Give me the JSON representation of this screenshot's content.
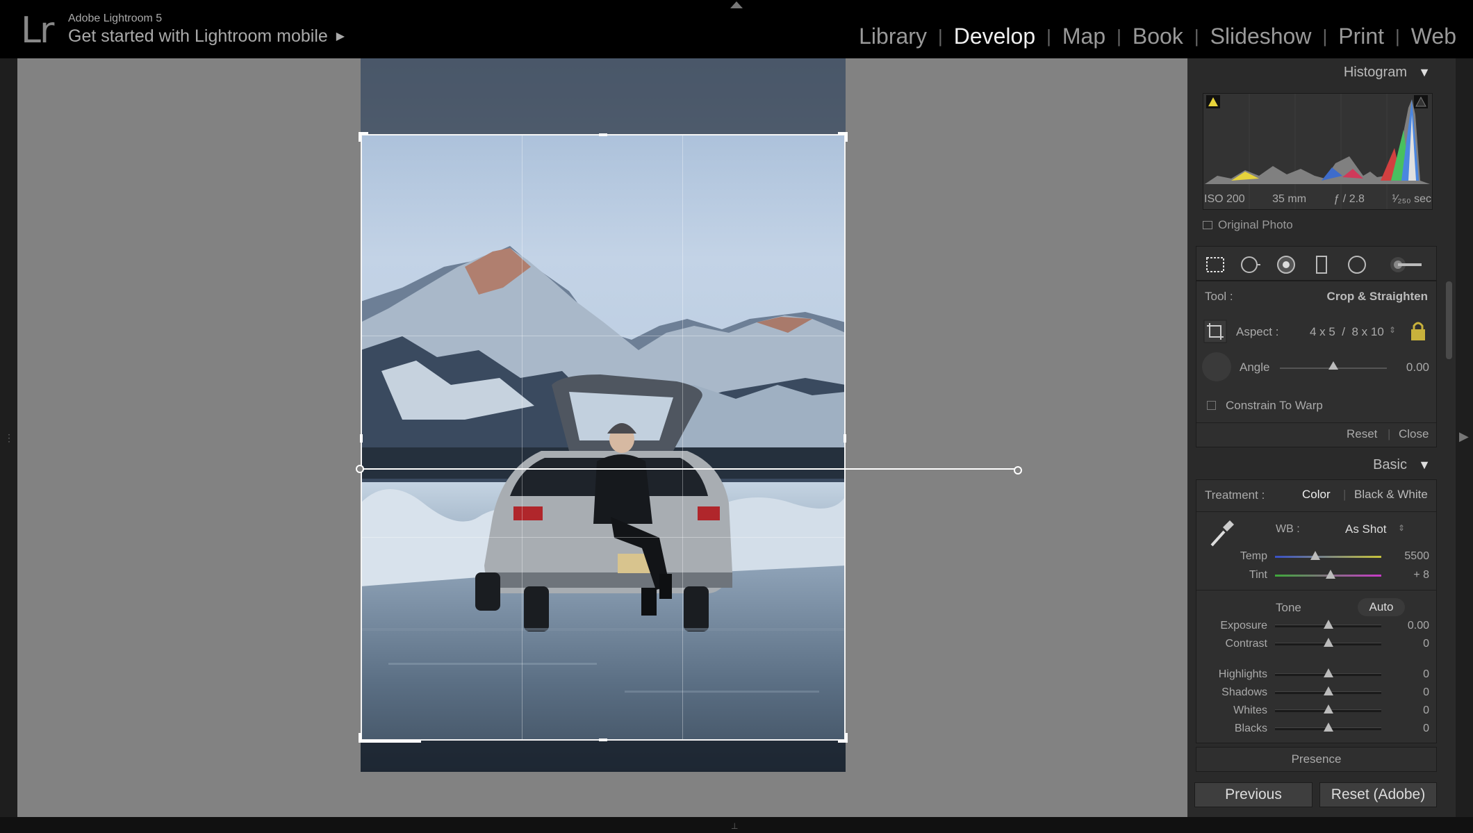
{
  "header": {
    "logo": "Lr",
    "app_name": "Adobe Lightroom 5",
    "mobile_prompt": "Get started with Lightroom mobile",
    "modules": [
      "Library",
      "Develop",
      "Map",
      "Book",
      "Slideshow",
      "Print",
      "Web"
    ],
    "active_module": "Develop"
  },
  "histogram": {
    "title": "Histogram",
    "iso": "ISO 200",
    "focal": "35 mm",
    "aperture": "ƒ / 2.8",
    "shutter": "¹⁄₂₅₀ sec",
    "original_photo": "Original Photo"
  },
  "tools": [
    "crop-overlay-icon",
    "spot-removal-icon",
    "red-eye-icon",
    "graduated-filter-icon",
    "radial-filter-icon",
    "adjustment-brush-icon"
  ],
  "crop": {
    "tool_label": "Tool :",
    "tool_value": "Crop & Straighten",
    "aspect_label": "Aspect :",
    "aspect_value": "4 x 5  /  8 x 10",
    "angle_label": "Angle",
    "angle_value": "0.00",
    "angle_level": 0.5,
    "constrain_label": "Constrain To Warp",
    "reset": "Reset",
    "close": "Close"
  },
  "basic": {
    "title": "Basic",
    "treatment_label": "Treatment :",
    "treatment_color": "Color",
    "treatment_bw": "Black & White",
    "wb_label": "WB :",
    "wb_value": "As Shot",
    "temp_label": "Temp",
    "temp_value": "5500",
    "tint_label": "Tint",
    "tint_value": "+ 8",
    "tone_label": "Tone",
    "auto_label": "Auto",
    "exposure_label": "Exposure",
    "exposure_value": "0.00",
    "contrast_label": "Contrast",
    "contrast_value": "0",
    "highlights_label": "Highlights",
    "highlights_value": "0",
    "shadows_label": "Shadows",
    "shadows_value": "0",
    "whites_label": "Whites",
    "whites_value": "0",
    "blacks_label": "Blacks",
    "blacks_value": "0",
    "presence_label": "Presence"
  },
  "footer": {
    "previous": "Previous",
    "reset": "Reset (Adobe)"
  }
}
